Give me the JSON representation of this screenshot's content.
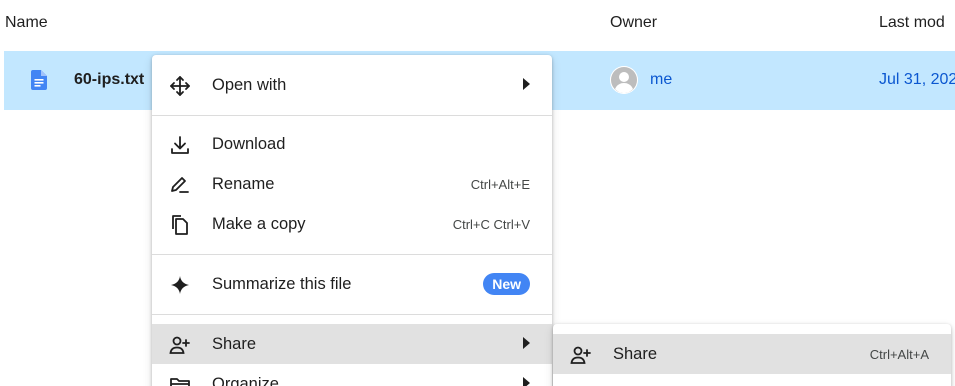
{
  "columns": {
    "name": "Name",
    "owner": "Owner",
    "last_modified": "Last mod"
  },
  "file": {
    "name": "60-ips.txt",
    "icon": "doc-icon",
    "owner": "me",
    "modified": "Jul 31, 202"
  },
  "context_menu": {
    "open_with": "Open with",
    "download": "Download",
    "rename": "Rename",
    "rename_shortcut": "Ctrl+Alt+E",
    "make_copy": "Make a copy",
    "make_copy_shortcut": "Ctrl+C Ctrl+V",
    "summarize": "Summarize this file",
    "summarize_badge": "New",
    "share": "Share",
    "organize": "Organize"
  },
  "share_submenu": {
    "share": "Share",
    "share_shortcut": "Ctrl+Alt+A"
  },
  "colors": {
    "selected_row": "#c2e7ff",
    "accent_text": "#0b57d0",
    "badge": "#4285f4",
    "hover": "#e1e1e1"
  }
}
